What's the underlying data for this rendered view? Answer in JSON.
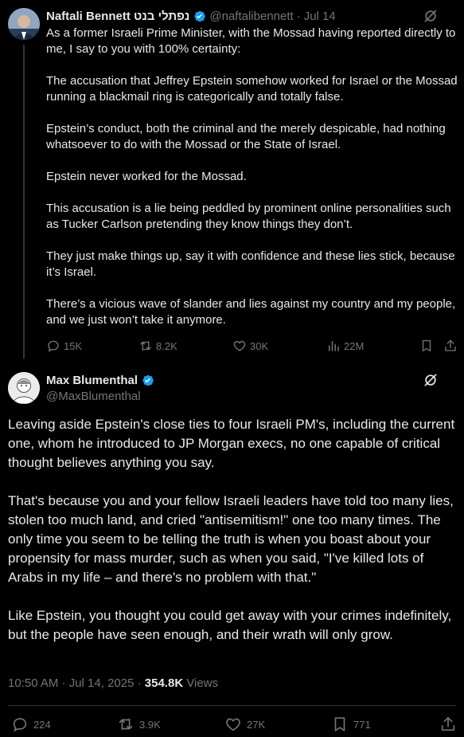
{
  "quoted_tweet": {
    "display_name": "Naftali Bennett נפתלי בנט",
    "handle": "@naftalibennett",
    "date": "Jul 14",
    "paragraphs": [
      "As a former Israeli Prime Minister, with the Mossad having reported directly to me, I say to you with 100% certainty:",
      "The accusation that Jeffrey Epstein somehow worked for Israel or the Mossad running a blackmail ring is categorically and totally false.",
      "Epstein’s conduct, both the criminal and the merely despicable, had nothing whatsoever to do with the Mossad or the State of Israel.",
      "Epstein never worked for the Mossad.",
      "This accusation is a lie being peddled by prominent online personalities such as Tucker Carlson pretending they know things they don’t.",
      "They just make things up, say it with confidence and these lies stick, because it’s Israel.",
      "There’s a vicious wave of slander and lies against my country and my people, and we just won’t take it anymore."
    ],
    "stats": {
      "replies": "15K",
      "reposts": "8.2K",
      "likes": "30K",
      "views": "22M"
    }
  },
  "main_tweet": {
    "display_name": "Max Blumenthal",
    "handle": "@MaxBlumenthal",
    "paragraphs": [
      "Leaving aside Epstein's close ties to four Israeli PM's, including the current one, whom he introduced to JP Morgan execs, no one capable of critical thought believes anything you say.",
      "That's because you and your fellow Israeli leaders have told too many lies, stolen too much land, and cried \"antisemitism!\" one too many times. The only time you seem to be telling the truth is when you boast about your propensity for mass murder, such as when you said, \"I've killed lots of Arabs in my life – and there's no problem with that.\"",
      "Like Epstein, you thought you could get away with your crimes indefinitely, but the people have seen enough, and their wrath will only grow."
    ],
    "timestamp": "10:50 AM · Jul 14, 2025",
    "views_count": "354.8K",
    "views_label": "Views",
    "stats": {
      "replies": "224",
      "reposts": "3.9K",
      "likes": "27K",
      "bookmarks": "771"
    }
  },
  "colors": {
    "background": "#000000",
    "text": "#e7e9ea",
    "muted": "#71767b",
    "verified": "#1d9bf0",
    "divider": "#2f3336"
  },
  "icons": [
    "verified-badge-icon",
    "grok-icon",
    "reply-icon",
    "repost-icon",
    "like-icon",
    "views-icon",
    "bookmark-icon",
    "share-icon"
  ]
}
